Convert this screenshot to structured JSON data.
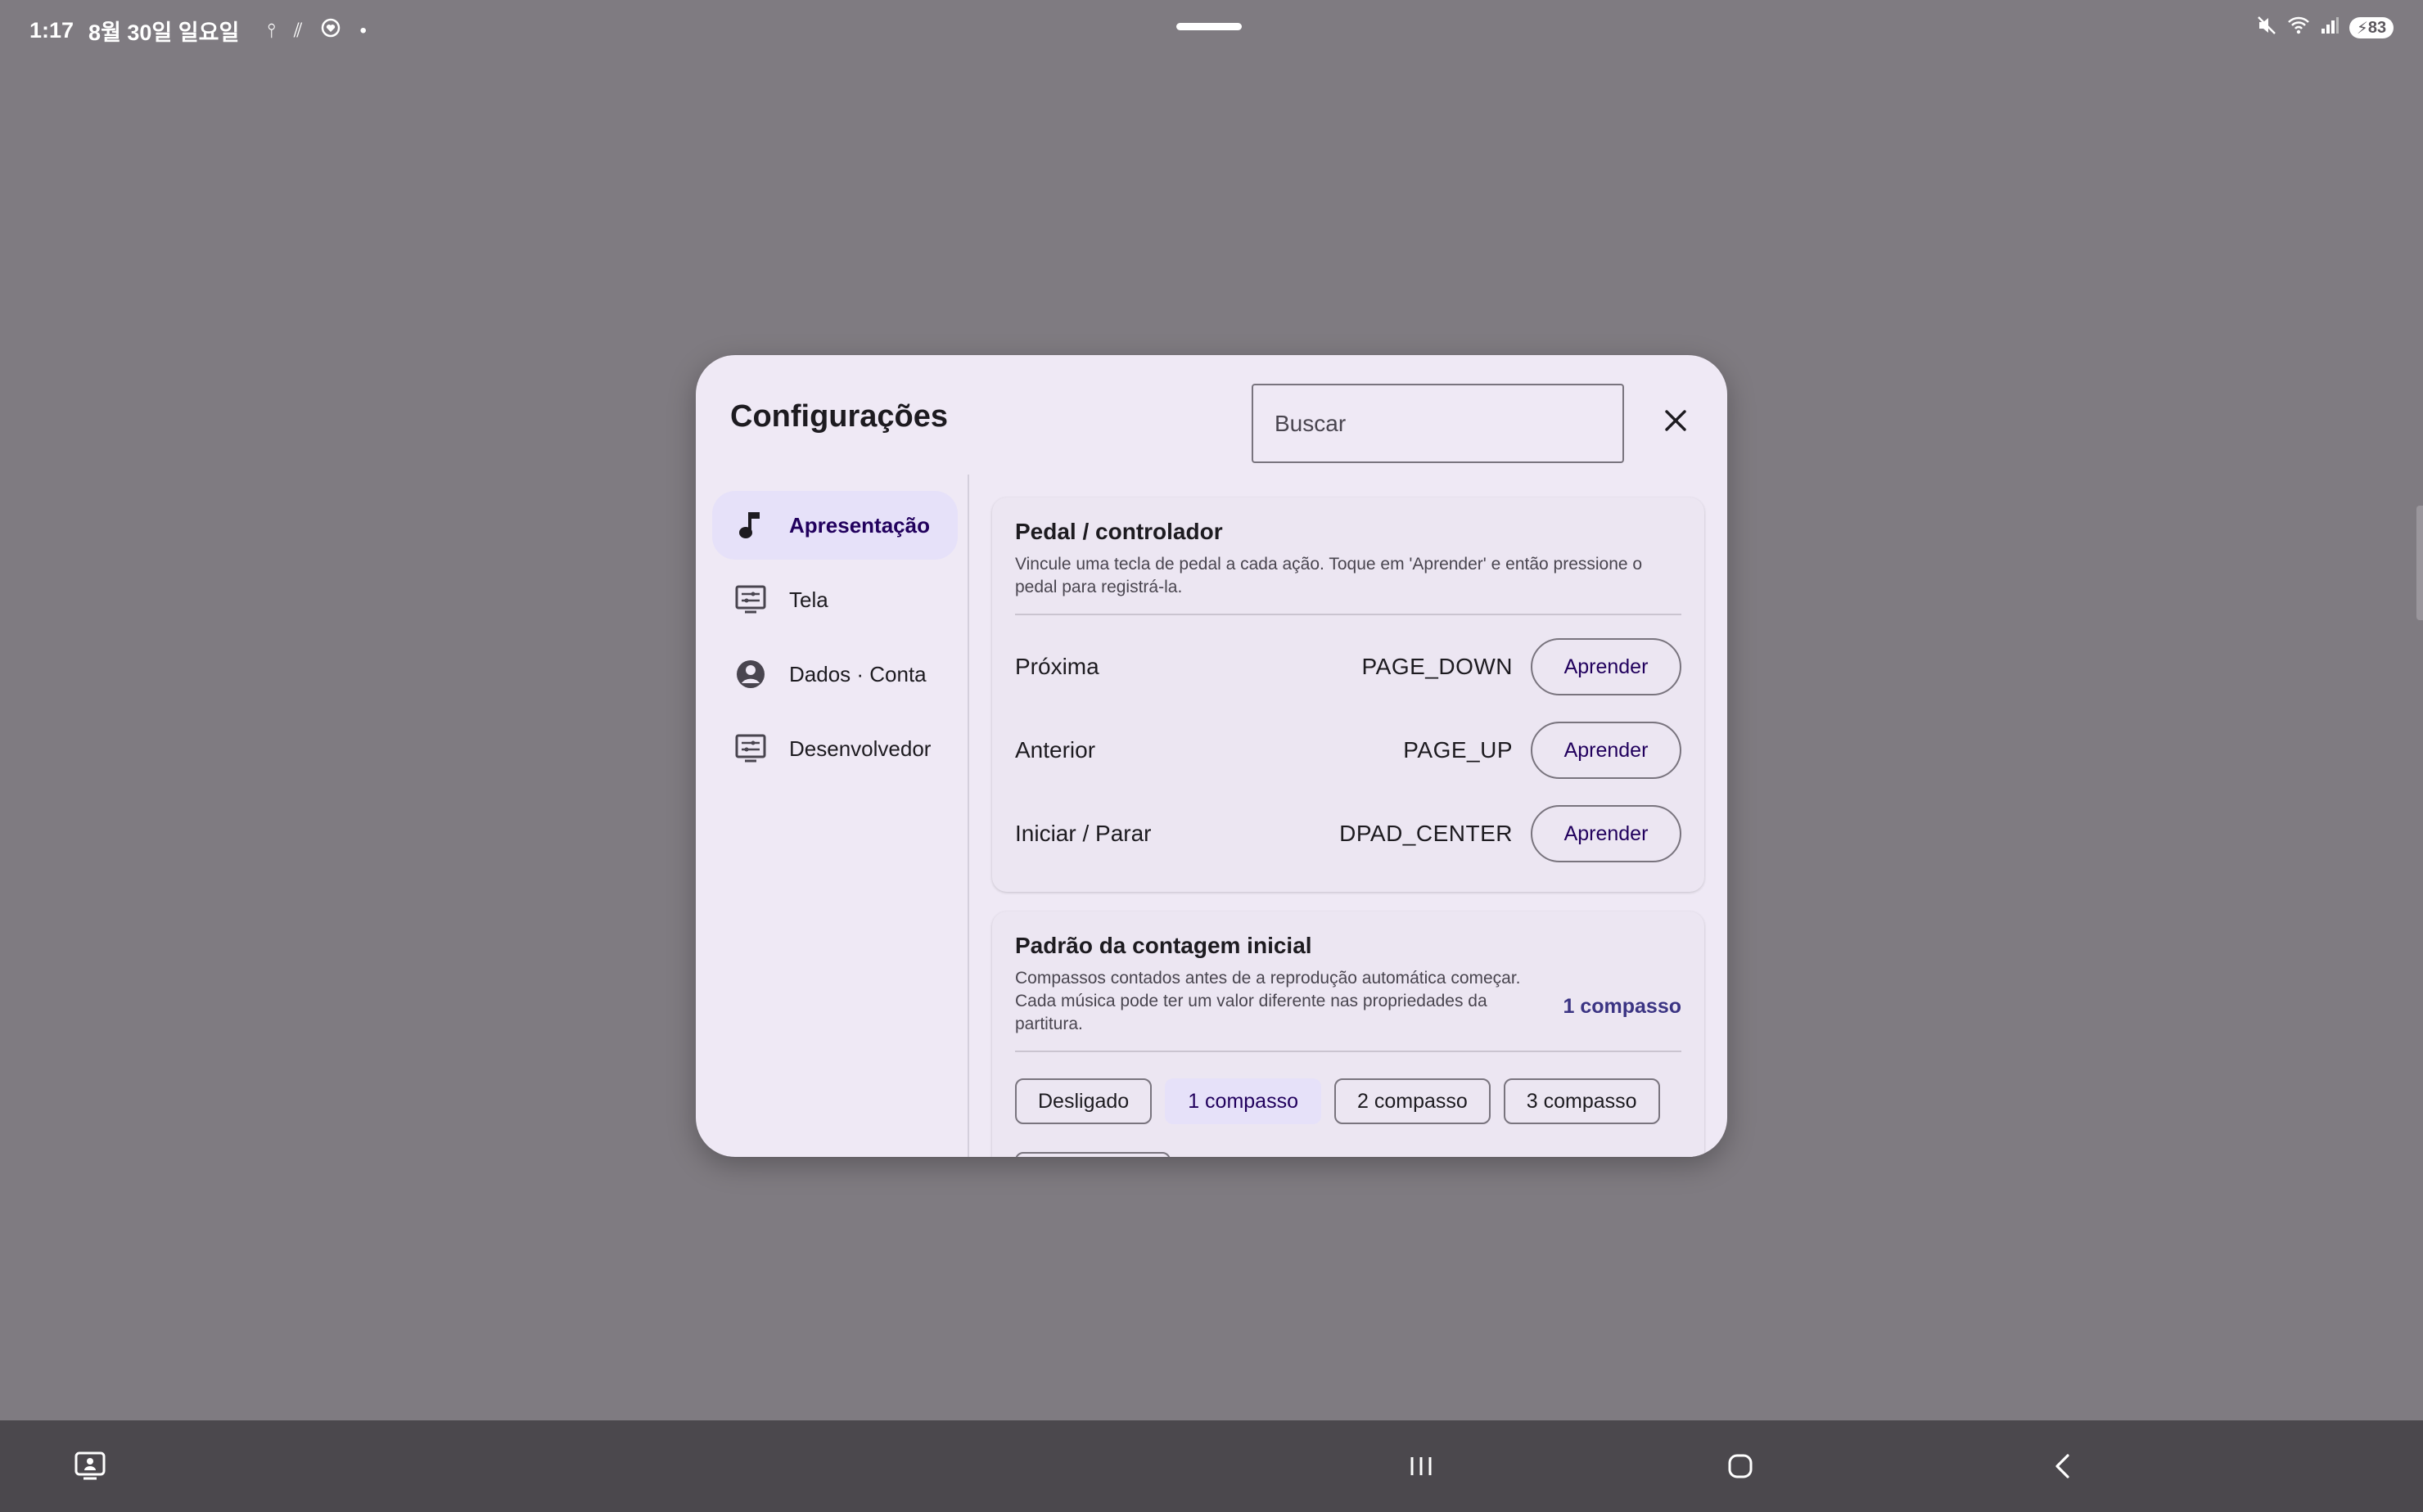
{
  "status_bar": {
    "time": "1:17",
    "date": "8월 30일 일요일",
    "battery": "83"
  },
  "dialog": {
    "title": "Configurações",
    "search_placeholder": "Buscar"
  },
  "sidebar": {
    "items": [
      {
        "label": "Apresentação",
        "icon": "music-note-icon",
        "active": true
      },
      {
        "label": "Tela",
        "icon": "display-settings-icon",
        "active": false
      },
      {
        "label": "Dados · Conta",
        "icon": "account-circle-icon",
        "active": false
      },
      {
        "label": "Desenvolvedor",
        "icon": "display-settings-icon",
        "active": false
      }
    ]
  },
  "pedal": {
    "title": "Pedal / controlador",
    "description": "Vincule uma tecla de pedal a cada ação. Toque em 'Aprender' e então pressione o pedal para registrá-la.",
    "rows": [
      {
        "name": "Próxima",
        "key": "PAGE_DOWN",
        "button": "Aprender"
      },
      {
        "name": "Anterior",
        "key": "PAGE_UP",
        "button": "Aprender"
      },
      {
        "name": "Iniciar / Parar",
        "key": "DPAD_CENTER",
        "button": "Aprender"
      }
    ]
  },
  "count_in": {
    "title": "Padrão da contagem inicial",
    "description": "Compassos contados antes de a reprodução automática começar. Cada música pode ter um valor diferente nas propriedades da partitura.",
    "current_value": "1 compasso",
    "options": [
      "Desligado",
      "1 compasso",
      "2 compasso",
      "3 compasso"
    ],
    "selected_index": 1
  },
  "colors": {
    "backdrop": "#7f7b81",
    "dialog_bg": "#efe9f5",
    "accent": "#21005d",
    "selected_bg": "#e6e1f9"
  }
}
